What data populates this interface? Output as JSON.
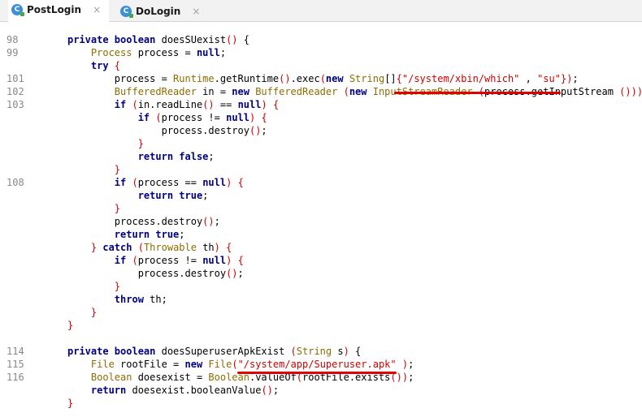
{
  "tabs": [
    {
      "label": "PostLogin",
      "icon": "c-class-icon",
      "icon_letter": "C",
      "close": "×"
    },
    {
      "label": "DoLogin",
      "icon": "c-class-icon",
      "icon_letter": "C",
      "close": "×"
    }
  ],
  "code_lines": [
    {
      "n": "98",
      "parts": [
        [
          "kw",
          "private "
        ],
        [
          "kw",
          "boolean "
        ],
        [
          "fn",
          "doesSUexist"
        ],
        [
          "paren",
          "()"
        ],
        [
          "fn",
          " {"
        ]
      ]
    },
    {
      "n": "99",
      "parts": [
        [
          "ty",
          "    Process "
        ],
        [
          "fn",
          "process = "
        ],
        [
          "kw",
          "null"
        ],
        [
          "fn",
          ";"
        ]
      ]
    },
    {
      "n": "",
      "parts": [
        [
          "kw",
          "    try "
        ],
        [
          "paren",
          "{"
        ]
      ]
    },
    {
      "n": "101",
      "parts": [
        [
          "fn",
          "        process = "
        ],
        [
          "ty",
          "Runtime"
        ],
        [
          "fn",
          "."
        ],
        [
          "fn",
          "getRuntime"
        ],
        [
          "paren",
          "()"
        ],
        [
          "fn",
          ".exec"
        ],
        [
          "paren",
          "("
        ],
        [
          "kw",
          "new "
        ],
        [
          "ty",
          "String"
        ],
        [
          "fn",
          "[]"
        ],
        [
          "paren",
          "{"
        ],
        [
          "str",
          "\"/system/xbin/which\""
        ],
        [
          "fn",
          " , "
        ],
        [
          "str",
          "\"su\""
        ],
        [
          "paren",
          "})"
        ],
        [
          "fn",
          ";"
        ]
      ]
    },
    {
      "n": "102",
      "parts": [
        [
          "ty",
          "        BufferedReader "
        ],
        [
          "fn",
          "in = "
        ],
        [
          "kw",
          "new "
        ],
        [
          "ty",
          "BufferedReader "
        ],
        [
          "paren",
          "("
        ],
        [
          "kw",
          "new "
        ],
        [
          "ty",
          "InputStreamReader "
        ],
        [
          "paren",
          "("
        ],
        [
          "fn",
          "process.getInputStream "
        ],
        [
          "paren",
          "()))"
        ],
        [
          "fn",
          ";"
        ]
      ]
    },
    {
      "n": "103",
      "parts": [
        [
          "kw",
          "        if "
        ],
        [
          "paren",
          "("
        ],
        [
          "fn",
          "in.readLine"
        ],
        [
          "paren",
          "()"
        ],
        [
          "fn",
          " == "
        ],
        [
          "kw",
          "null"
        ],
        [
          "paren",
          ")"
        ],
        [
          "fn",
          " "
        ],
        [
          "paren",
          "{"
        ]
      ]
    },
    {
      "n": "",
      "parts": [
        [
          "kw",
          "            if "
        ],
        [
          "paren",
          "("
        ],
        [
          "fn",
          "process != "
        ],
        [
          "kw",
          "null"
        ],
        [
          "paren",
          ")"
        ],
        [
          "fn",
          " "
        ],
        [
          "paren",
          "{"
        ]
      ]
    },
    {
      "n": "",
      "parts": [
        [
          "fn",
          "                process.destroy"
        ],
        [
          "paren",
          "()"
        ],
        [
          "fn",
          ";"
        ]
      ]
    },
    {
      "n": "",
      "parts": [
        [
          "paren",
          "            }"
        ]
      ]
    },
    {
      "n": "",
      "parts": [
        [
          "kw",
          "            return false"
        ],
        [
          "fn",
          ";"
        ]
      ]
    },
    {
      "n": "",
      "parts": [
        [
          "paren",
          "        }"
        ]
      ]
    },
    {
      "n": "108",
      "parts": [
        [
          "kw",
          "        if "
        ],
        [
          "paren",
          "("
        ],
        [
          "fn",
          "process == "
        ],
        [
          "kw",
          "null"
        ],
        [
          "paren",
          ")"
        ],
        [
          "fn",
          " "
        ],
        [
          "paren",
          "{"
        ]
      ]
    },
    {
      "n": "",
      "parts": [
        [
          "kw",
          "            return true"
        ],
        [
          "fn",
          ";"
        ]
      ]
    },
    {
      "n": "",
      "parts": [
        [
          "paren",
          "        }"
        ]
      ]
    },
    {
      "n": "",
      "parts": [
        [
          "fn",
          "        process.destroy"
        ],
        [
          "paren",
          "()"
        ],
        [
          "fn",
          ";"
        ]
      ]
    },
    {
      "n": "",
      "parts": [
        [
          "kw",
          "        return true"
        ],
        [
          "fn",
          ";"
        ]
      ]
    },
    {
      "n": "",
      "parts": [
        [
          "paren",
          "    } "
        ],
        [
          "kw",
          "catch "
        ],
        [
          "paren",
          "("
        ],
        [
          "ty",
          "Throwable "
        ],
        [
          "fn",
          "th"
        ],
        [
          "paren",
          ")"
        ],
        [
          "fn",
          " "
        ],
        [
          "paren",
          "{"
        ]
      ]
    },
    {
      "n": "",
      "parts": [
        [
          "kw",
          "        if "
        ],
        [
          "paren",
          "("
        ],
        [
          "fn",
          "process != "
        ],
        [
          "kw",
          "null"
        ],
        [
          "paren",
          ")"
        ],
        [
          "fn",
          " "
        ],
        [
          "paren",
          "{"
        ]
      ]
    },
    {
      "n": "",
      "parts": [
        [
          "fn",
          "            process.destroy"
        ],
        [
          "paren",
          "()"
        ],
        [
          "fn",
          ";"
        ]
      ]
    },
    {
      "n": "",
      "parts": [
        [
          "paren",
          "        }"
        ]
      ]
    },
    {
      "n": "",
      "parts": [
        [
          "kw",
          "        throw "
        ],
        [
          "fn",
          "th;"
        ]
      ]
    },
    {
      "n": "",
      "parts": [
        [
          "paren",
          "    }"
        ]
      ]
    },
    {
      "n": "",
      "parts": [
        [
          "paren",
          "}"
        ]
      ]
    },
    {
      "n": "",
      "parts": []
    },
    {
      "n": "114",
      "parts": [
        [
          "kw",
          "private "
        ],
        [
          "kw",
          "boolean "
        ],
        [
          "fn",
          "doesSuperuserApkExist "
        ],
        [
          "paren",
          "("
        ],
        [
          "ty",
          "String "
        ],
        [
          "fn",
          "s"
        ],
        [
          "paren",
          ")"
        ],
        [
          "fn",
          " {"
        ]
      ]
    },
    {
      "n": "115",
      "parts": [
        [
          "ty",
          "    File "
        ],
        [
          "fn",
          "rootFile = "
        ],
        [
          "kw",
          "new "
        ],
        [
          "ty",
          "File"
        ],
        [
          "paren",
          "("
        ],
        [
          "str",
          "\"/system/app/Superuser.apk\""
        ],
        [
          "fn",
          " "
        ],
        [
          "paren",
          ")"
        ],
        [
          "fn",
          ";"
        ]
      ]
    },
    {
      "n": "116",
      "parts": [
        [
          "ty",
          "    Boolean "
        ],
        [
          "fn",
          "doesexist = "
        ],
        [
          "ty",
          "Boolean"
        ],
        [
          "fn",
          ".valueOf"
        ],
        [
          "paren",
          "("
        ],
        [
          "fn",
          "rootFile.exists"
        ],
        [
          "paren",
          "())"
        ],
        [
          "fn",
          ";"
        ]
      ]
    },
    {
      "n": "",
      "parts": [
        [
          "kw",
          "    return "
        ],
        [
          "fn",
          "doesexist.booleanValue"
        ],
        [
          "paren",
          "()"
        ],
        [
          "fn",
          ";"
        ]
      ]
    },
    {
      "n": "",
      "parts": [
        [
          "paren",
          "}"
        ]
      ]
    }
  ]
}
